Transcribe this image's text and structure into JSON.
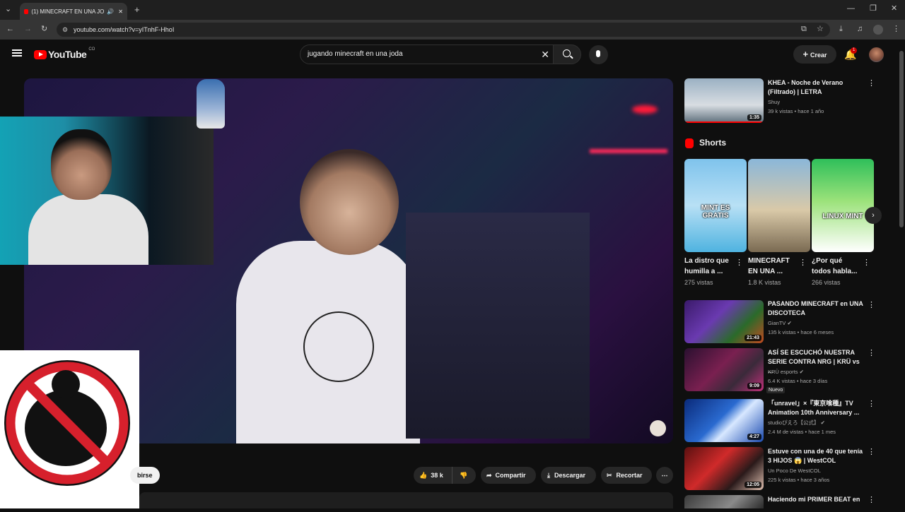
{
  "browser": {
    "tab_title": "(1) MINECRAFT EN UNA JO",
    "url": "youtube.com/watch?v=yITnhF-HhoI"
  },
  "youtube": {
    "logo_text": "YouTube",
    "country": "CO",
    "search_value": "jugando minecraft en una joda",
    "create_label": "Crear",
    "notifications_count": "1"
  },
  "video": {
    "subscribe_partial": "birse",
    "likes": "38 k",
    "share_label": "Compartir",
    "download_label": "Descargar",
    "clip_label": "Recortar"
  },
  "sidebar": {
    "top_video": {
      "title": "KHEA - Noche de Verano (Filtrado) | LETRA",
      "channel": "Shuy",
      "meta": "39 k vistas • hace 1 año",
      "duration": "1:35"
    },
    "shorts_title": "Shorts",
    "shorts": [
      {
        "title": "La distro que humilla a ...",
        "views": "275 vistas",
        "overlay": "MINT ES GRATIS"
      },
      {
        "title": "MINECRAFT EN UNA ...",
        "views": "1.8 K vistas",
        "overlay": ""
      },
      {
        "title": "¿Por qué todos habla...",
        "views": "266 vistas",
        "overlay": "LINUX MINT"
      }
    ],
    "videos": [
      {
        "title": "PASANDO MINECRAFT en UNA DISCOTECA",
        "channel": "GianTV",
        "meta": "135 k vistas • hace 6 meses",
        "duration": "21:43",
        "badge": ""
      },
      {
        "title": "ASÍ SE ESCUCHÓ NUESTRA SERIE CONTRA NRG | KRÜ vs ...",
        "channel": "KRÜ esports",
        "meta": "6.4 K vistas • hace 3 días",
        "duration": "9:09",
        "badge": "Nuevo"
      },
      {
        "title": "「unravel」×『東京喰種』TV Animation 10th Anniversary ...",
        "channel": "studioぴえろ【公式】",
        "meta": "2.4 M de vistas • hace 1 mes",
        "duration": "4:27",
        "badge": ""
      },
      {
        "title": "Estuve con una de 40 que tenía 3 HIJOS 😱 | WestCOL",
        "channel": "Un Poco De WestCOL",
        "meta": "225 k vistas • hace 3 años",
        "duration": "12:05",
        "badge": ""
      },
      {
        "title": "Haciendo mi PRIMER BEAT en",
        "channel": "",
        "meta": "",
        "duration": "",
        "badge": ""
      }
    ]
  }
}
